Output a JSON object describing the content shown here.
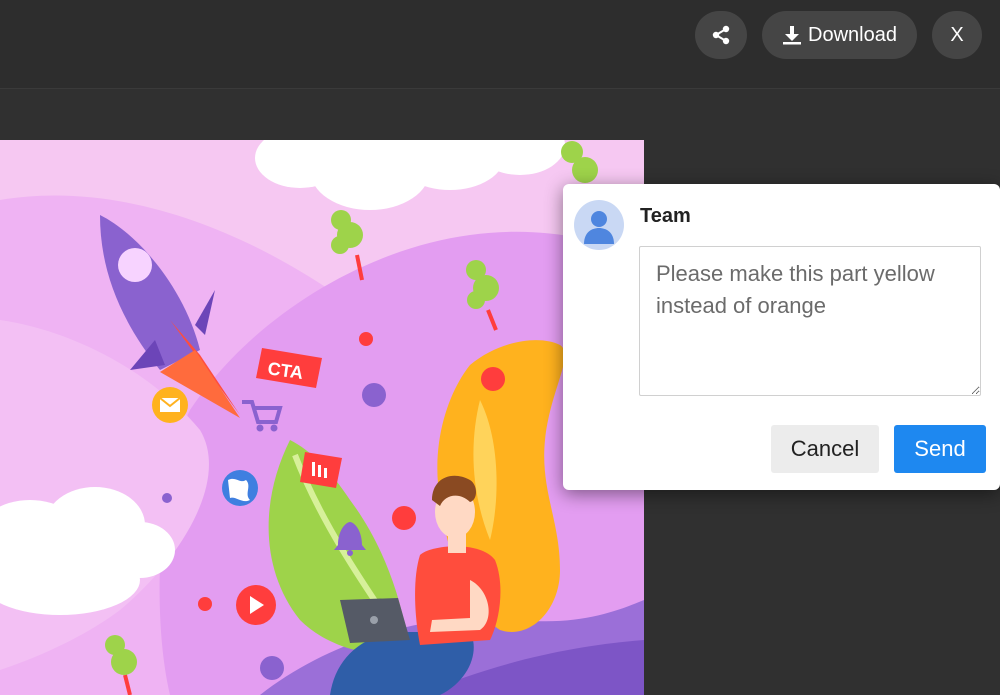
{
  "toolbar": {
    "share_icon": "share-icon",
    "download_icon": "download-icon",
    "download_label": "Download",
    "close_label": "X"
  },
  "comment": {
    "author": "Team",
    "avatar_icon": "user-avatar-icon",
    "text": "Please make this part yellow instead of orange",
    "cancel_label": "Cancel",
    "send_label": "Send"
  },
  "illustration": {
    "cta_label": "CTA"
  },
  "colors": {
    "topbar": "#2d2d2d",
    "background": "#303030",
    "button": "#454545",
    "send": "#1e88f0",
    "cancel": "#ececec"
  }
}
